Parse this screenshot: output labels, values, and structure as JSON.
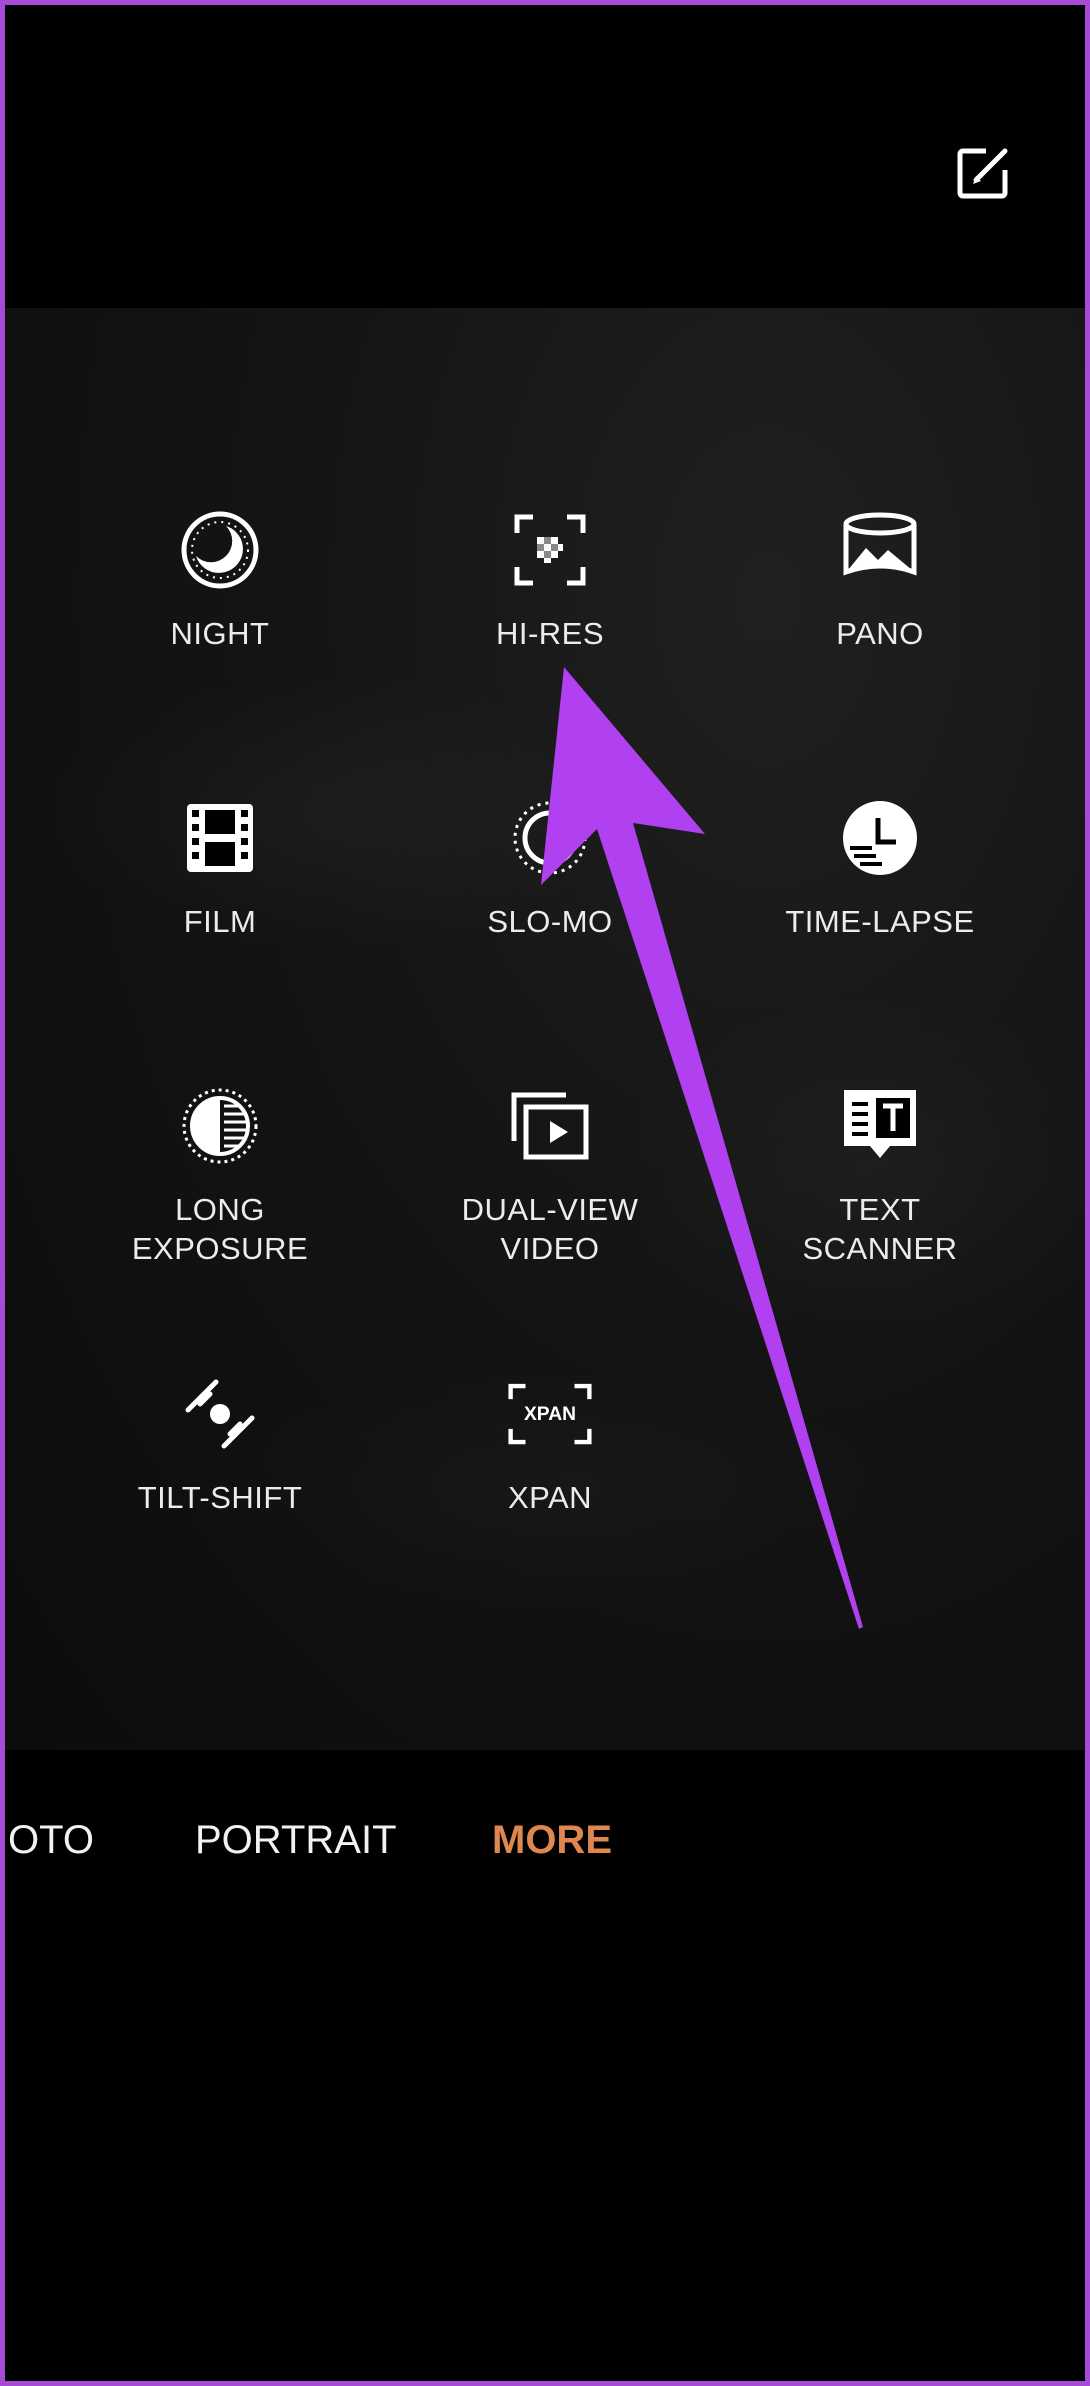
{
  "header": {
    "edit_icon": "edit-square-icon"
  },
  "modes": [
    {
      "label": "NIGHT",
      "icon": "night-moon-icon"
    },
    {
      "label": "HI-RES",
      "icon": "hi-res-grid-icon"
    },
    {
      "label": "PANO",
      "icon": "pano-landscape-icon"
    },
    {
      "label": "FILM",
      "icon": "film-strip-icon"
    },
    {
      "label": "SLO-MO",
      "icon": "slo-mo-dial-icon"
    },
    {
      "label": "TIME-LAPSE",
      "icon": "time-lapse-clock-icon"
    },
    {
      "label": "LONG\nEXPOSURE",
      "icon": "long-exposure-icon"
    },
    {
      "label": "DUAL-VIEW\nVIDEO",
      "icon": "dual-view-video-icon"
    },
    {
      "label": "TEXT\nSCANNER",
      "icon": "text-scanner-icon"
    },
    {
      "label": "TILT-SHIFT",
      "icon": "tilt-shift-icon"
    },
    {
      "label": "XPAN",
      "icon": "xpan-icon",
      "icon_text": "XPAN"
    }
  ],
  "tabs": [
    {
      "label": "OTO",
      "active": false
    },
    {
      "label": "PORTRAIT",
      "active": false
    },
    {
      "label": "MORE",
      "active": true
    }
  ],
  "colors": {
    "frame_border": "#a64bd8",
    "active_tab": "#e0874f",
    "annotation_arrow": "#b040f0"
  }
}
